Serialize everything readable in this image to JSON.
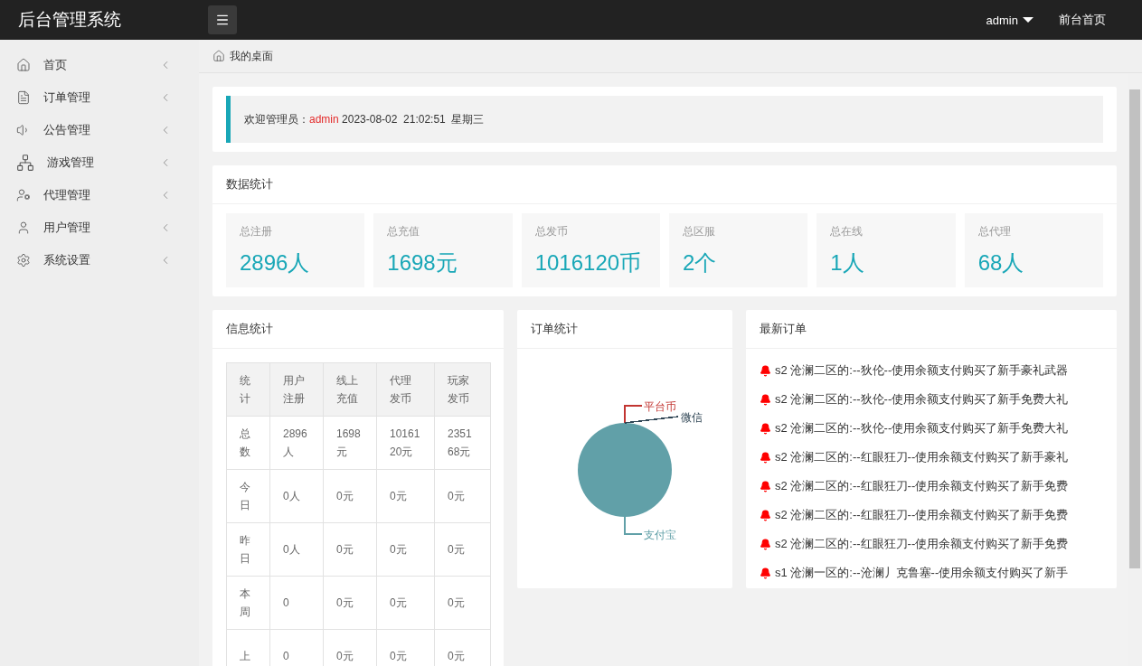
{
  "header": {
    "title": "后台管理系统",
    "user": "admin",
    "front_link": "前台首页"
  },
  "sidebar": {
    "items": [
      {
        "label": "首页"
      },
      {
        "label": "订单管理"
      },
      {
        "label": "公告管理"
      },
      {
        "label": "游戏管理"
      },
      {
        "label": "代理管理"
      },
      {
        "label": "用户管理"
      },
      {
        "label": "系统设置"
      }
    ]
  },
  "breadcrumb": "我的桌面",
  "welcome": {
    "prefix": "欢迎管理员：",
    "user": "admin",
    "datetime": "2023-08-02  21:02:51  星期三"
  },
  "stats": {
    "title": "数据统计",
    "items": [
      {
        "label": "总注册",
        "value": "2896人"
      },
      {
        "label": "总充值",
        "value": "1698元"
      },
      {
        "label": "总发币",
        "value": "1016120币"
      },
      {
        "label": "总区服",
        "value": "2个"
      },
      {
        "label": "总在线",
        "value": "1人"
      },
      {
        "label": "总代理",
        "value": "68人"
      }
    ]
  },
  "info": {
    "title": "信息统计",
    "columns": [
      "统计",
      "用户注册",
      "线上充值",
      "代理发币",
      "玩家发币"
    ],
    "rows": [
      [
        "总数",
        "2896人",
        "1698元",
        "1016120元",
        "235168元"
      ],
      [
        "今日",
        "0人",
        "0元",
        "0元",
        "0元"
      ],
      [
        "昨日",
        "0人",
        "0元",
        "0元",
        "0元"
      ],
      [
        "本周",
        "0",
        "0元",
        "0元",
        "0元"
      ],
      [
        "上",
        "0",
        "0元",
        "0元",
        "0元"
      ]
    ]
  },
  "order_chart": {
    "title": "订单统计",
    "labels": [
      {
        "text": "平台币",
        "color": "#c23531"
      },
      {
        "text": "微信",
        "color": "#2f4554"
      },
      {
        "text": "支付宝",
        "color": "#61a0a8"
      }
    ]
  },
  "latest": {
    "title": "最新订单",
    "items": [
      "s2 沧澜二区的:--狄伦--使用余额支付购买了新手豪礼武器",
      "s2 沧澜二区的:--狄伦--使用余额支付购买了新手免费大礼",
      "s2 沧澜二区的:--狄伦--使用余额支付购买了新手免费大礼",
      "s2 沧澜二区的:--红眼狂刀--使用余额支付购买了新手豪礼",
      "s2 沧澜二区的:--红眼狂刀--使用余额支付购买了新手免费",
      "s2 沧澜二区的:--红眼狂刀--使用余额支付购买了新手免费",
      "s2 沧澜二区的:--红眼狂刀--使用余额支付购买了新手免费",
      "s1 沧澜一区的:--沧澜丿克鲁塞--使用余额支付购买了新手"
    ]
  }
}
